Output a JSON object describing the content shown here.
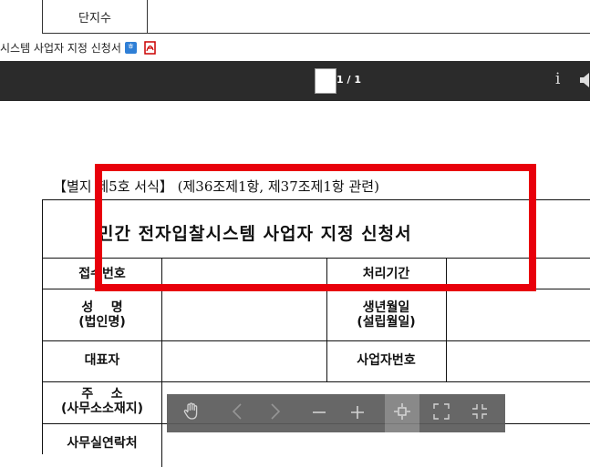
{
  "top_table": {
    "label": "단지수"
  },
  "file_line": {
    "text": "시스템 사업자 지정 신청서"
  },
  "toolbar": {
    "page_indicator": "1 / 1",
    "info_label": "i"
  },
  "document": {
    "header_note": "【별지 제5호 서식】 (제36조제1항, 제37조제1항 관련)",
    "form_title": "민간 전자입찰시스템 사업자 지정 신청서",
    "rows": [
      {
        "left_label": "접수번호",
        "right_label": "처리기간"
      },
      {
        "left_label_line1": "성    명",
        "left_label_line2": "(법인명)",
        "right_label_line1": "생년월일",
        "right_label_line2": "(설립월일)"
      },
      {
        "left_label": "대표자",
        "right_label": "사업자번호"
      },
      {
        "left_label_line1": "주    소",
        "left_label_line2": "(사무소소재지)"
      },
      {
        "left_label": "사무실연락처"
      }
    ]
  },
  "highlight": {
    "color": "#e8000b"
  },
  "zoom_toolbar": {
    "buttons": [
      {
        "name": "hand-tool",
        "icon": "hand-icon"
      },
      {
        "name": "prev",
        "icon": "chevron-left-icon"
      },
      {
        "name": "next",
        "icon": "chevron-right-icon"
      },
      {
        "name": "zoom-out",
        "icon": "minus-icon"
      },
      {
        "name": "zoom-in",
        "icon": "plus-icon"
      },
      {
        "name": "fit-page",
        "icon": "fit-page-icon"
      },
      {
        "name": "fullscreen",
        "icon": "fullscreen-icon"
      },
      {
        "name": "exit-fullscreen",
        "icon": "exit-fullscreen-icon"
      }
    ]
  }
}
